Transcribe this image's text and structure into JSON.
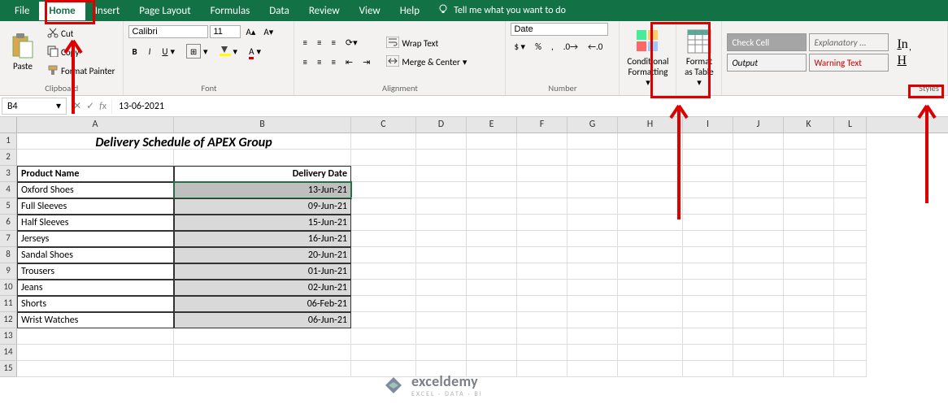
{
  "menu": {
    "tabs": [
      "File",
      "Home",
      "Insert",
      "Page Layout",
      "Formulas",
      "Data",
      "Review",
      "View",
      "Help"
    ],
    "active": "Home",
    "tell_me": "Tell me what you want to do"
  },
  "ribbon": {
    "clipboard": {
      "label": "Clipboard",
      "paste": "Paste",
      "cut": "Cut",
      "copy": "Copy",
      "format_painter": "Format Painter"
    },
    "font": {
      "label": "Font",
      "name": "Calibri",
      "size": "11"
    },
    "alignment": {
      "label": "Alignment",
      "wrap": "Wrap Text",
      "merge": "Merge & Center"
    },
    "number": {
      "label": "Number",
      "format": "Date"
    },
    "cond_fmt": "Conditional Formatting",
    "fmt_table": "Format as Table",
    "styles": {
      "label": "Styles",
      "check": "Check Cell",
      "explanatory": "Explanatory ...",
      "output": "Output",
      "warning": "Warning Text"
    }
  },
  "namebox": "B4",
  "formula": "13-06-2021",
  "columns": [
    "A",
    "B",
    "C",
    "D",
    "E",
    "F",
    "G",
    "H",
    "I",
    "J",
    "K",
    "L"
  ],
  "sheet": {
    "title": "Delivery Schedule of APEX Group",
    "headers": [
      "Product Name",
      "Delivery Date"
    ],
    "rows": [
      {
        "product": "Oxford Shoes",
        "date": "13-Jun-21"
      },
      {
        "product": "Full Sleeves",
        "date": "09-Jun-21"
      },
      {
        "product": "Half Sleeves",
        "date": "15-Jun-21"
      },
      {
        "product": "Jerseys",
        "date": "16-Jun-21"
      },
      {
        "product": "Sandal Shoes",
        "date": "20-Jun-21"
      },
      {
        "product": "Trousers",
        "date": "01-Jun-21"
      },
      {
        "product": "Jeans",
        "date": "02-Jun-21"
      },
      {
        "product": "Shorts",
        "date": "06-Feb-21"
      },
      {
        "product": "Wrist Watches",
        "date": "06-Jun-21"
      }
    ]
  },
  "watermark": {
    "brand": "exceldemy",
    "tag": "EXCEL · DATA · BI"
  }
}
